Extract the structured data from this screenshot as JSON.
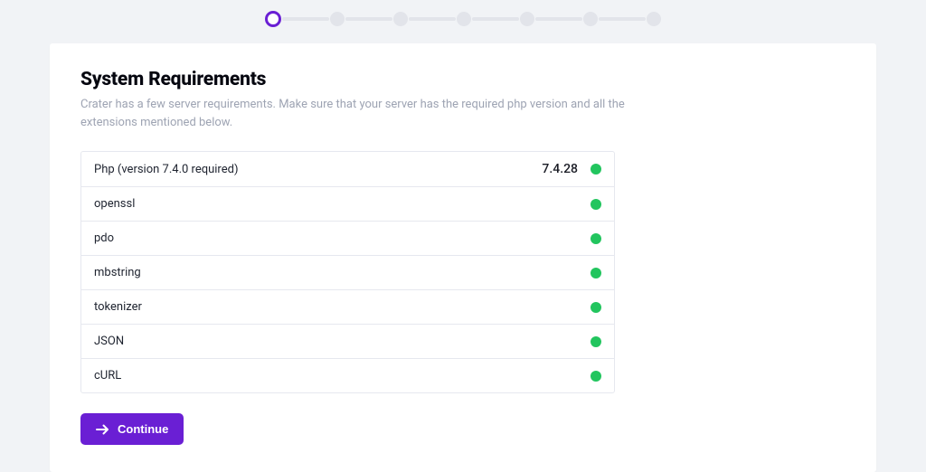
{
  "stepper": {
    "total": 7,
    "active_index": 0
  },
  "header": {
    "title": "System Requirements",
    "subtitle": "Crater has a few server requirements. Make sure that your server has the required php version and all the extensions mentioned below."
  },
  "requirements": [
    {
      "label": "Php (version 7.4.0 required)",
      "version": "7.4.28",
      "ok": true
    },
    {
      "label": "openssl",
      "version": "",
      "ok": true
    },
    {
      "label": "pdo",
      "version": "",
      "ok": true
    },
    {
      "label": "mbstring",
      "version": "",
      "ok": true
    },
    {
      "label": "tokenizer",
      "version": "",
      "ok": true
    },
    {
      "label": "JSON",
      "version": "",
      "ok": true
    },
    {
      "label": "cURL",
      "version": "",
      "ok": true
    }
  ],
  "actions": {
    "continue_label": "Continue"
  },
  "colors": {
    "accent": "#6a1fd4",
    "ok": "#22c55e"
  }
}
